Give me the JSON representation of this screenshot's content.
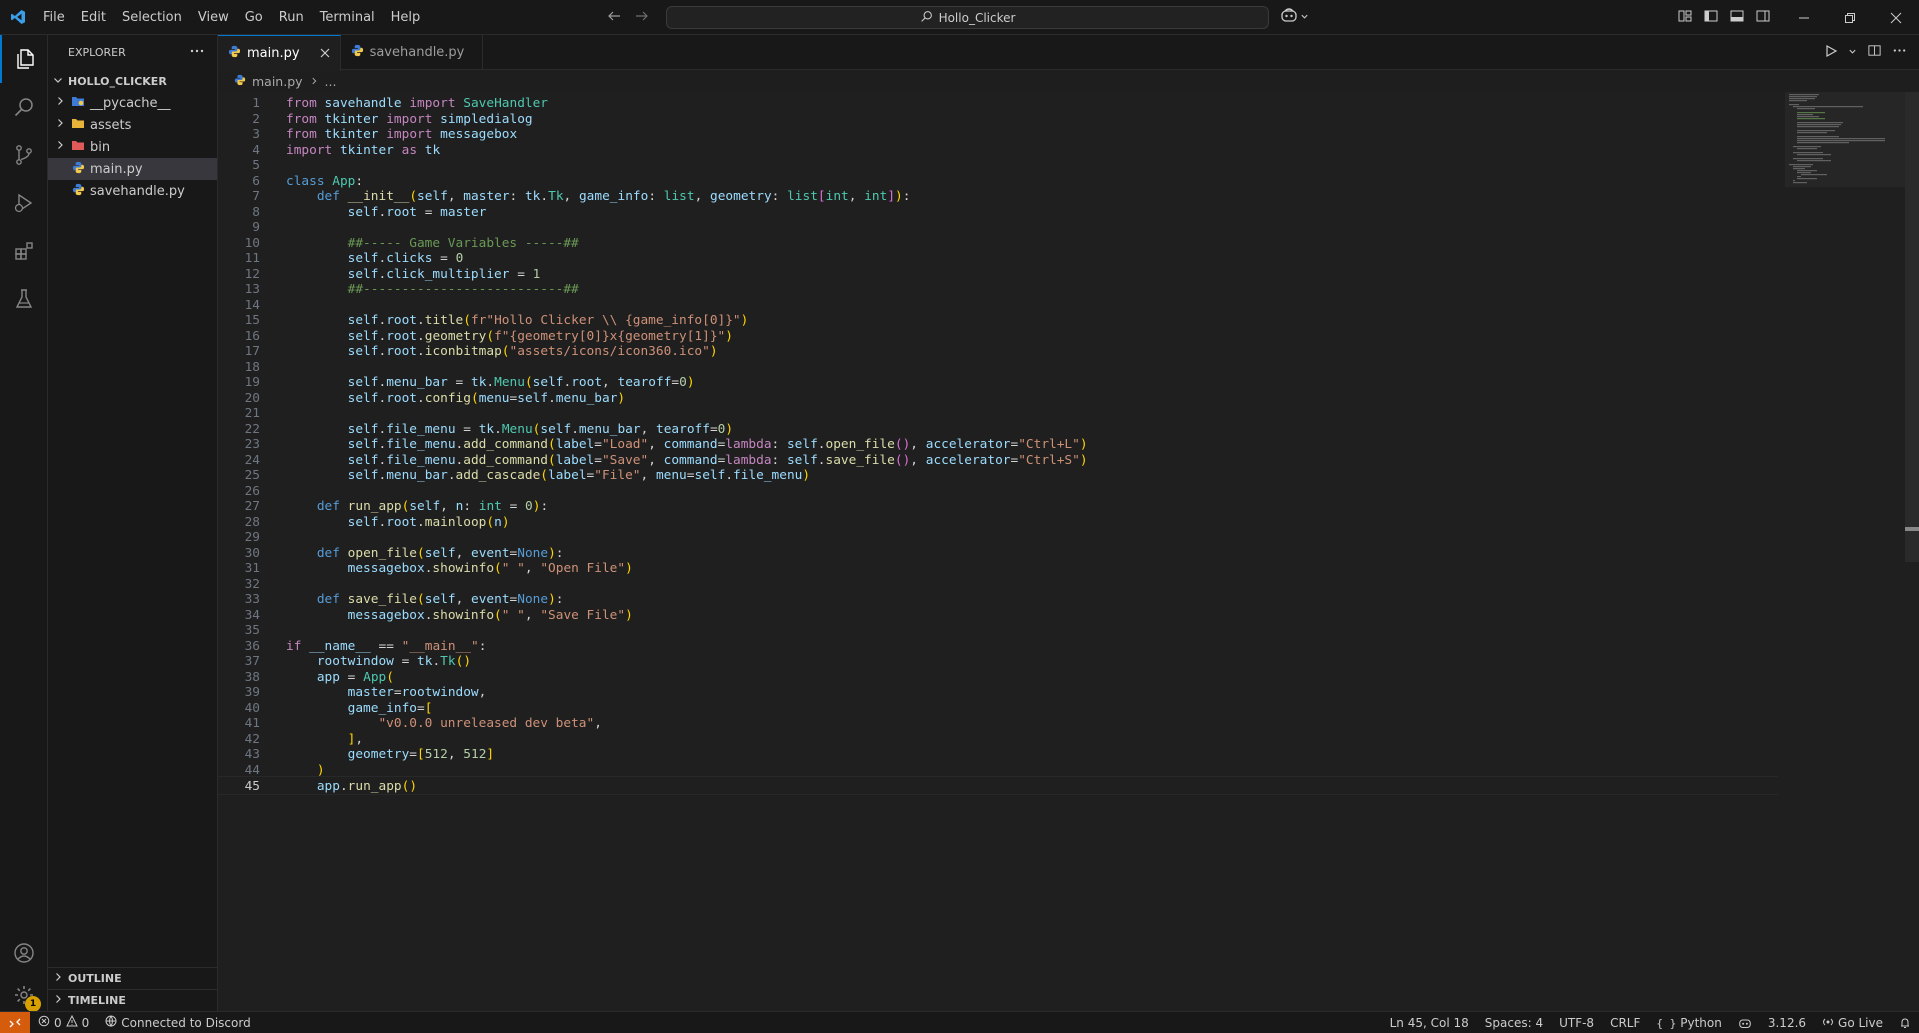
{
  "menubar": [
    "File",
    "Edit",
    "Selection",
    "View",
    "Go",
    "Run",
    "Terminal",
    "Help"
  ],
  "command_center": "Hollo_Clicker",
  "explorer": {
    "title": "EXPLORER",
    "project": "HOLLO_CLICKER",
    "items": [
      {
        "label": "__pycache__",
        "type": "folder"
      },
      {
        "label": "assets",
        "type": "folder"
      },
      {
        "label": "bin",
        "type": "folder"
      },
      {
        "label": "main.py",
        "type": "file"
      },
      {
        "label": "savehandle.py",
        "type": "file"
      }
    ],
    "outline": "OUTLINE",
    "timeline": "TIMELINE"
  },
  "tabs": [
    {
      "label": "main.py",
      "active": true
    },
    {
      "label": "savehandle.py",
      "active": false
    }
  ],
  "breadcrumb": {
    "file": "main.py",
    "rest": "..."
  },
  "editor": {
    "line_numbers": [
      "1",
      "2",
      "3",
      "4",
      "5",
      "6",
      "7",
      "8",
      "9",
      "10",
      "11",
      "12",
      "13",
      "14",
      "15",
      "16",
      "17",
      "18",
      "19",
      "20",
      "21",
      "22",
      "23",
      "24",
      "25",
      "26",
      "27",
      "28",
      "29",
      "30",
      "31",
      "32",
      "33",
      "34",
      "35",
      "36",
      "37",
      "38",
      "39",
      "40",
      "41",
      "42",
      "43",
      "44",
      "45"
    ],
    "code": [
      "from savehandle import SaveHandler",
      "from tkinter import simpledialog",
      "from tkinter import messagebox",
      "import tkinter as tk",
      "",
      "class App:",
      "    def __init__(self, master: tk.Tk, game_info: list, geometry: list[int, int]):",
      "        self.root = master",
      "",
      "        ##----- Game Variables -----##",
      "        self.clicks = 0",
      "        self.click_multiplier = 1",
      "        ##--------------------------##",
      "",
      "        self.root.title(fr\"Hollo Clicker \\\\ {game_info[0]}\")",
      "        self.root.geometry(f\"{geometry[0]}x{geometry[1]}\")",
      "        self.root.iconbitmap(\"assets/icons/icon360.ico\")",
      "",
      "        self.menu_bar = tk.Menu(self.root, tearoff=0)",
      "        self.root.config(menu=self.menu_bar)",
      "",
      "        self.file_menu = tk.Menu(self.menu_bar, tearoff=0)",
      "        self.file_menu.add_command(label=\"Load\", command=lambda: self.open_file(), accelerator=\"Ctrl+L\")",
      "        self.file_menu.add_command(label=\"Save\", command=lambda: self.save_file(), accelerator=\"Ctrl+S\")",
      "        self.menu_bar.add_cascade(label=\"File\", menu=self.file_menu)",
      "",
      "    def run_app(self, n: int = 0):",
      "        self.root.mainloop(n)",
      "",
      "    def open_file(self, event=None):",
      "        messagebox.showinfo(\" \", \"Open File\")",
      "",
      "    def save_file(self, event=None):",
      "        messagebox.showinfo(\" \", \"Save File\")",
      "",
      "if __name__ == \"__main__\":",
      "    rootwindow = tk.Tk()",
      "    app = App(",
      "        master=rootwindow,",
      "        game_info=[",
      "            \"v0.0.0 unreleased dev beta\",",
      "        ],",
      "        geometry=[512, 512]",
      "    )",
      "    app.run_app()"
    ],
    "current_line": 45
  },
  "statusbar": {
    "errors": "0",
    "warnings": "0",
    "discord": "Connected to Discord",
    "position": "Ln 45, Col 18",
    "spaces": "Spaces: 4",
    "encoding": "UTF-8",
    "eol": "CRLF",
    "language": "Python",
    "python_version": "3.12.6",
    "golive": "Go Live"
  },
  "accounts_badge": "1",
  "colors": {
    "accent": "#0078d4",
    "remote": "#d55b0d",
    "selection": "#37373d"
  }
}
